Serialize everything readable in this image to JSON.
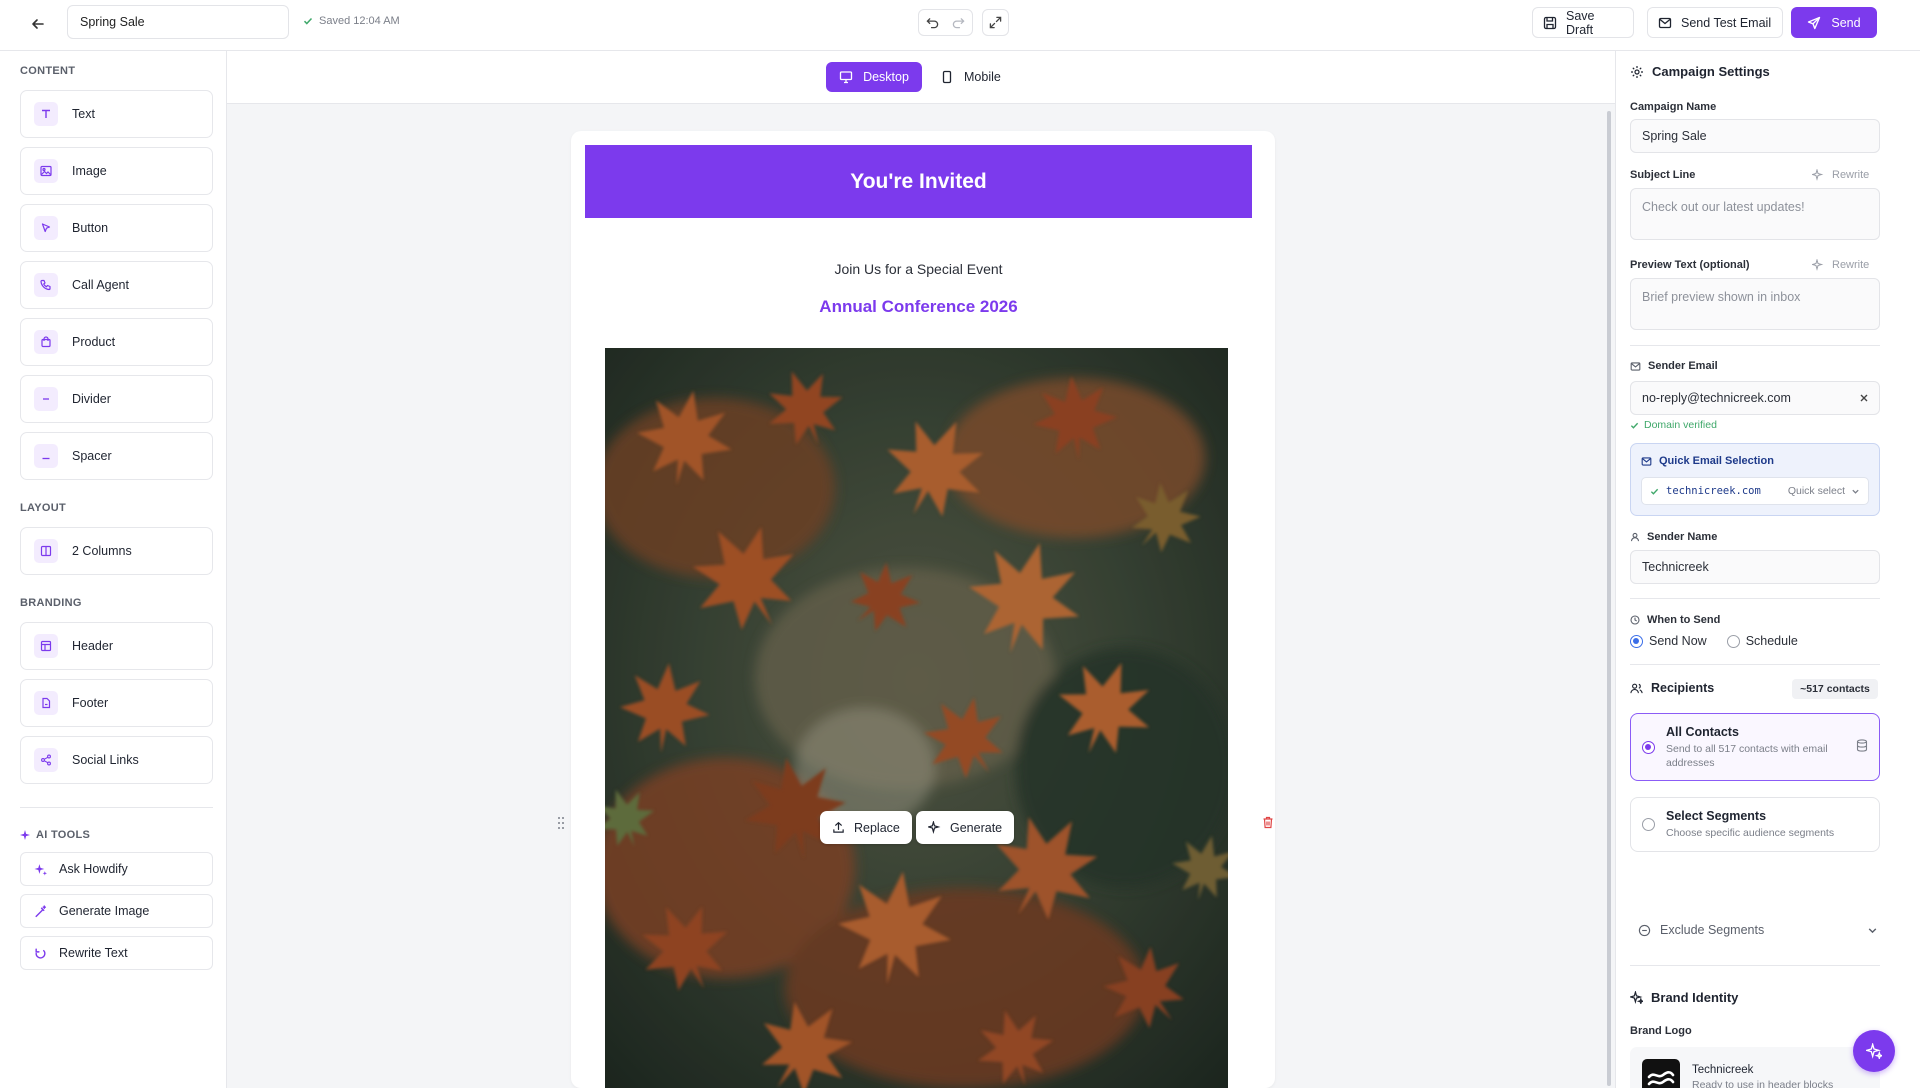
{
  "topbar": {
    "campaign_name": "Spring Sale",
    "saved_text": "Saved 12:04 AM",
    "save_draft_label": "Save Draft",
    "send_test_label": "Send Test Email",
    "send_label": "Send"
  },
  "sidebar": {
    "content_title": "CONTENT",
    "content_blocks": [
      {
        "label": "Text",
        "icon": "text-icon"
      },
      {
        "label": "Image",
        "icon": "image-icon"
      },
      {
        "label": "Button",
        "icon": "cursor-icon"
      },
      {
        "label": "Call Agent",
        "icon": "phone-icon"
      },
      {
        "label": "Product",
        "icon": "shopping-bag-icon"
      },
      {
        "label": "Divider",
        "icon": "minus-icon"
      },
      {
        "label": "Spacer",
        "icon": "spacer-icon"
      }
    ],
    "layout_title": "LAYOUT",
    "layout_blocks": [
      {
        "label": "2 Columns",
        "icon": "columns-icon"
      }
    ],
    "branding_title": "BRANDING",
    "branding_blocks": [
      {
        "label": "Header",
        "icon": "header-layout-icon"
      },
      {
        "label": "Footer",
        "icon": "footer-file-icon"
      },
      {
        "label": "Social Links",
        "icon": "share-icon"
      }
    ],
    "ai_title": "AI TOOLS",
    "ai_tools": [
      {
        "label": "Ask Howdify",
        "icon": "sparkles-icon"
      },
      {
        "label": "Generate Image",
        "icon": "magic-wand-icon"
      },
      {
        "label": "Rewrite Text",
        "icon": "refresh-icon"
      }
    ]
  },
  "canvas": {
    "desktop_label": "Desktop",
    "mobile_label": "Mobile",
    "email": {
      "header_text": "You're Invited",
      "subheading": "Join Us for a Special Event",
      "title": "Annual Conference 2026",
      "replace_label": "Replace",
      "generate_label": "Generate"
    }
  },
  "settings": {
    "title": "Campaign Settings",
    "campaign_name_label": "Campaign Name",
    "campaign_name_value": "Spring Sale",
    "subject_label": "Subject Line",
    "subject_placeholder": "Check out our latest updates!",
    "rewrite_label": "Rewrite",
    "preview_label": "Preview Text (optional)",
    "preview_placeholder": "Brief preview shown in inbox",
    "sender_email_label": "Sender Email",
    "sender_email_value": "no-reply@technicreek.com",
    "domain_verified": "Domain verified",
    "quick_email_title": "Quick Email Selection",
    "quick_email_domain": "technicreek.com",
    "quick_select_label": "Quick select",
    "sender_name_label": "Sender Name",
    "sender_name_value": "Technicreek",
    "when_label": "When to Send",
    "send_now_label": "Send Now",
    "schedule_label": "Schedule",
    "recipients_label": "Recipients",
    "recipients_count": "~517 contacts",
    "all_contacts_title": "All Contacts",
    "all_contacts_desc": "Send to all 517 contacts with email addresses",
    "segments_title": "Select Segments",
    "segments_desc": "Choose specific audience segments",
    "exclude_label": "Exclude Segments",
    "brand_identity_label": "Brand Identity",
    "brand_logo_label": "Brand Logo",
    "logo_name": "Technicreek",
    "logo_desc": "Ready to use in header blocks"
  },
  "colors": {
    "accent": "#7c3aed",
    "success": "#3fa86a",
    "danger": "#e04545"
  }
}
